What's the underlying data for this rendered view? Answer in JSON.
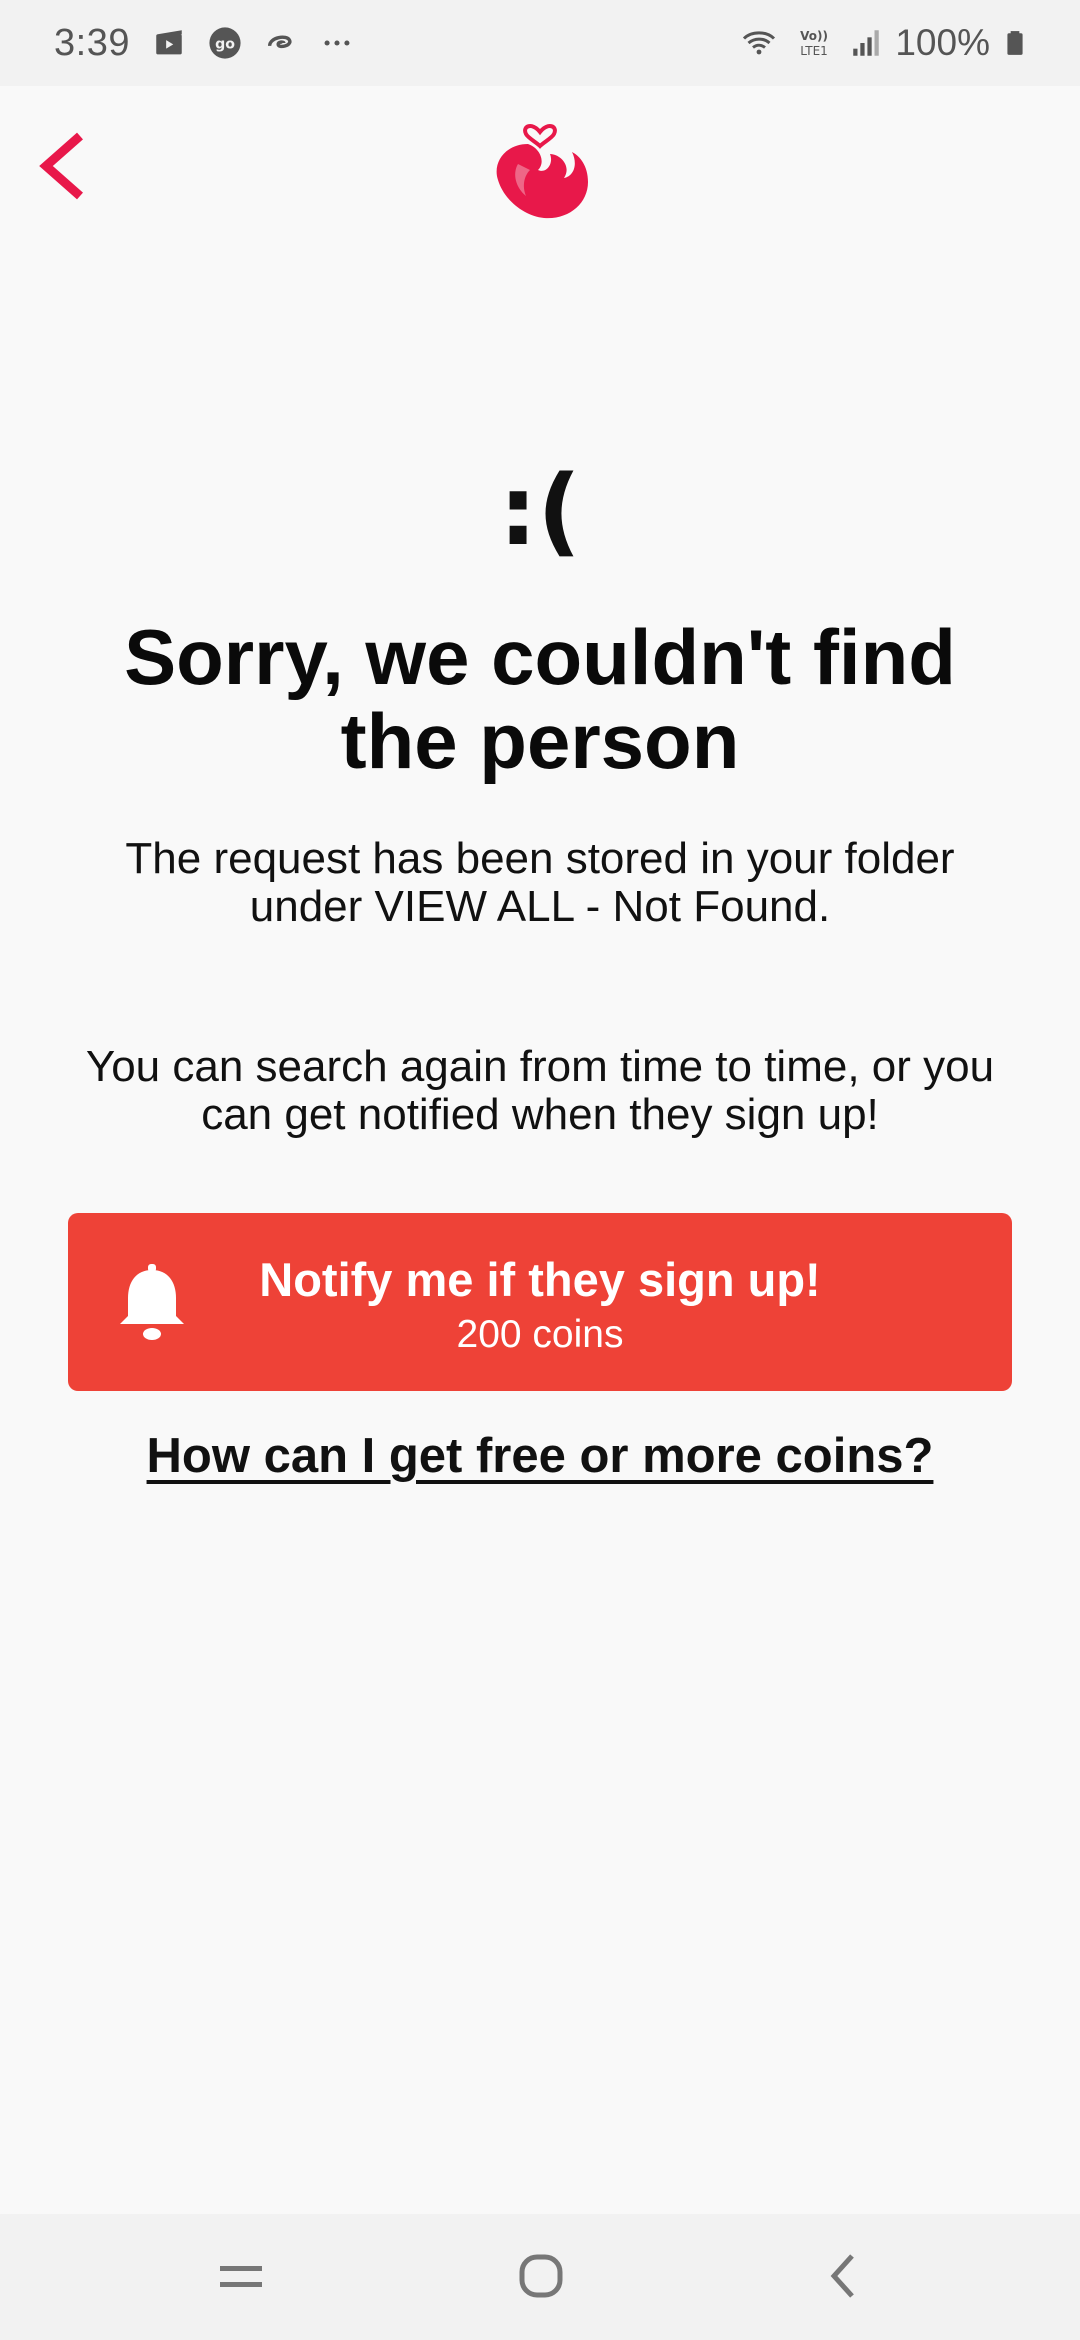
{
  "status_bar": {
    "time": "3:39",
    "battery": "100%",
    "icons": [
      "clapperboard-icon",
      "go-icon",
      "swirl-icon",
      "more-dots-icon",
      "wifi-icon",
      "volte-icon",
      "signal-icon",
      "battery-icon"
    ]
  },
  "header": {
    "back_icon": "chevron-left-icon",
    "logo": "heart-flame-logo",
    "accent_color": "#e8184a"
  },
  "main": {
    "sad_face": ":(",
    "headline": "Sorry, we couldn't find the person",
    "subtext": "The request has been stored in your folder under VIEW ALL - Not Found.",
    "hint": "You can search again from time to time, or you can get notified when they sign up!",
    "notify_button": {
      "title": "Notify me if they sign up!",
      "cost": "200 coins",
      "icon": "bell-icon",
      "color": "#ee4237"
    },
    "coins_link": "How can I get free or more coins?"
  },
  "nav_bar": {
    "buttons": [
      "recent-apps-icon",
      "home-icon",
      "back-icon"
    ]
  }
}
